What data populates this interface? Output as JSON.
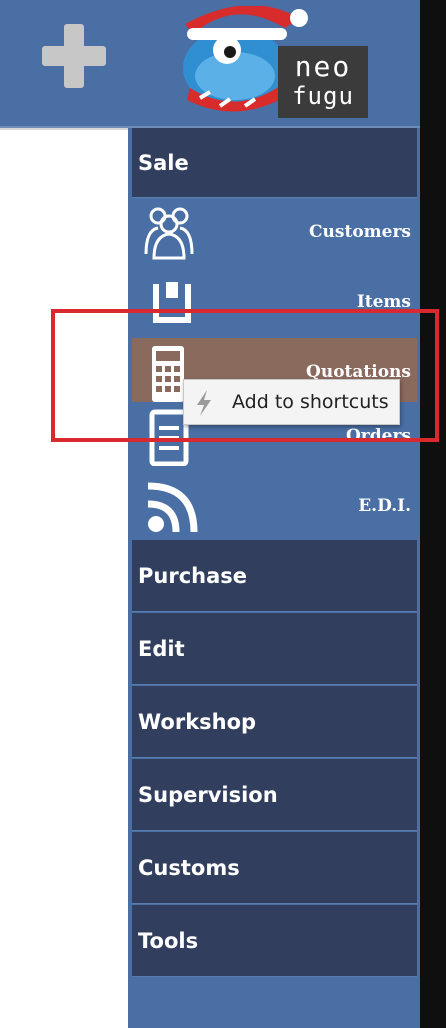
{
  "logo": {
    "line1": "neo",
    "line2": "fugu"
  },
  "sale": {
    "label": "Sale",
    "items": [
      {
        "label": "Customers",
        "icon": "customers-icon"
      },
      {
        "label": "Items",
        "icon": "items-icon"
      },
      {
        "label": "Quotations",
        "icon": "calculator-icon"
      },
      {
        "label": "Orders",
        "icon": "document-icon"
      },
      {
        "label": "E.D.I.",
        "icon": "rss-icon"
      }
    ]
  },
  "menus": [
    "Purchase",
    "Edit",
    "Workshop",
    "Supervision",
    "Customs",
    "Tools"
  ],
  "context_menu": {
    "item_label": "Add to shortcuts",
    "icon": "bolt-icon"
  },
  "colors": {
    "topbar": "#4a6fa5",
    "menu_header": "#313e5d",
    "hover_item": "#8b6a5e",
    "highlight": "#d9282f"
  }
}
